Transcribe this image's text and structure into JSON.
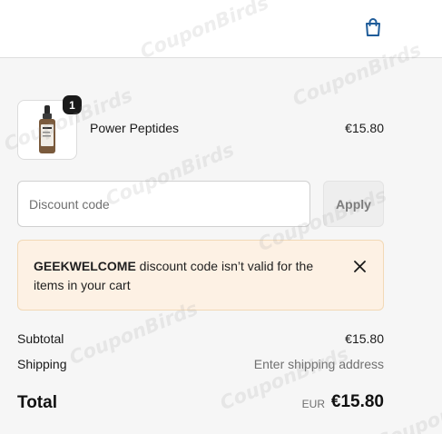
{
  "header": {
    "cart_icon": "shopping-bag-icon",
    "accent_color": "#1f5c99"
  },
  "cart": {
    "items": [
      {
        "name": "Power Peptides",
        "price": "€15.80",
        "quantity": "1",
        "image_icon": "serum-bottle-icon"
      }
    ]
  },
  "discount": {
    "placeholder": "Discount code",
    "value": "",
    "apply_label": "Apply"
  },
  "alert": {
    "code": "GEEKWELCOME",
    "message": " discount code isn’t valid for the items in your cart",
    "close_icon": "close-icon",
    "background_color": "#fdf1e4"
  },
  "summary": {
    "subtotal_label": "Subtotal",
    "subtotal_value": "€15.80",
    "shipping_label": "Shipping",
    "shipping_value": "Enter shipping address",
    "total_label": "Total",
    "total_currency": "EUR",
    "total_value": "€15.80"
  },
  "watermark": "CouponBirds"
}
